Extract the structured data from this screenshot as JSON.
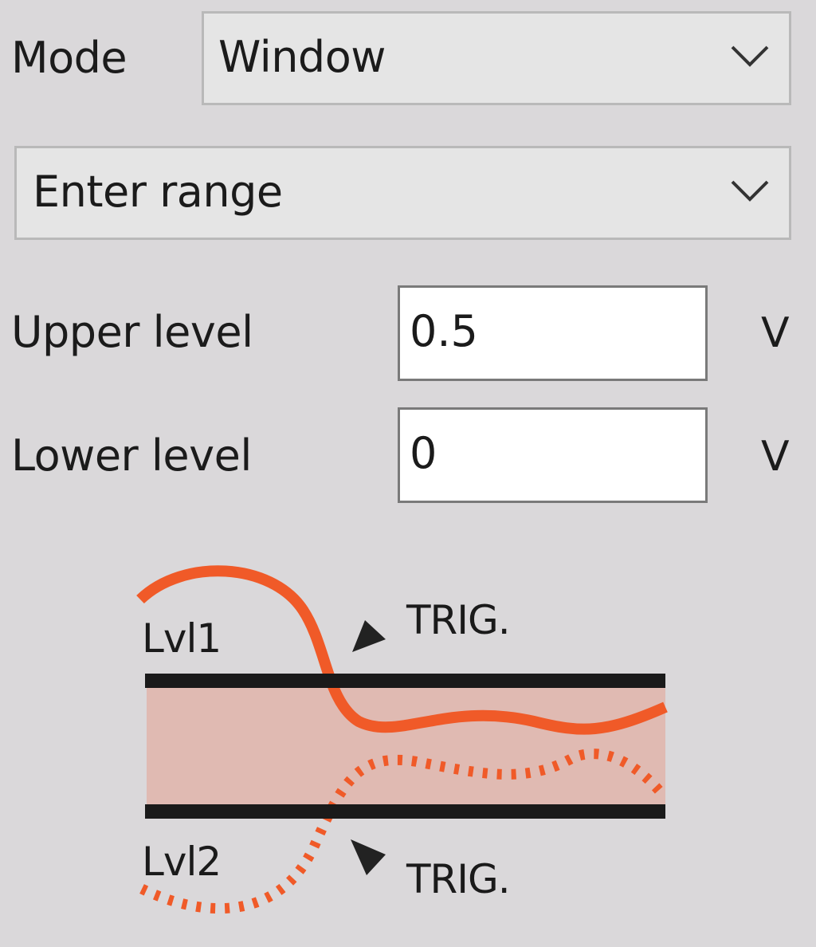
{
  "mode": {
    "label": "Mode",
    "value": "Window"
  },
  "range": {
    "value": "Enter range"
  },
  "upper": {
    "label": "Upper level",
    "value": "0.5",
    "unit": "V"
  },
  "lower": {
    "label": "Lower level",
    "value": "0",
    "unit": "V"
  },
  "diagram": {
    "lvl1": "Lvl1",
    "lvl2": "Lvl2",
    "trig_top": "TRIG.",
    "trig_bottom": "TRIG.",
    "colors": {
      "signal": "#f05a28",
      "window_fill": "#e0bab2",
      "level_line": "#1a1a1a"
    }
  }
}
